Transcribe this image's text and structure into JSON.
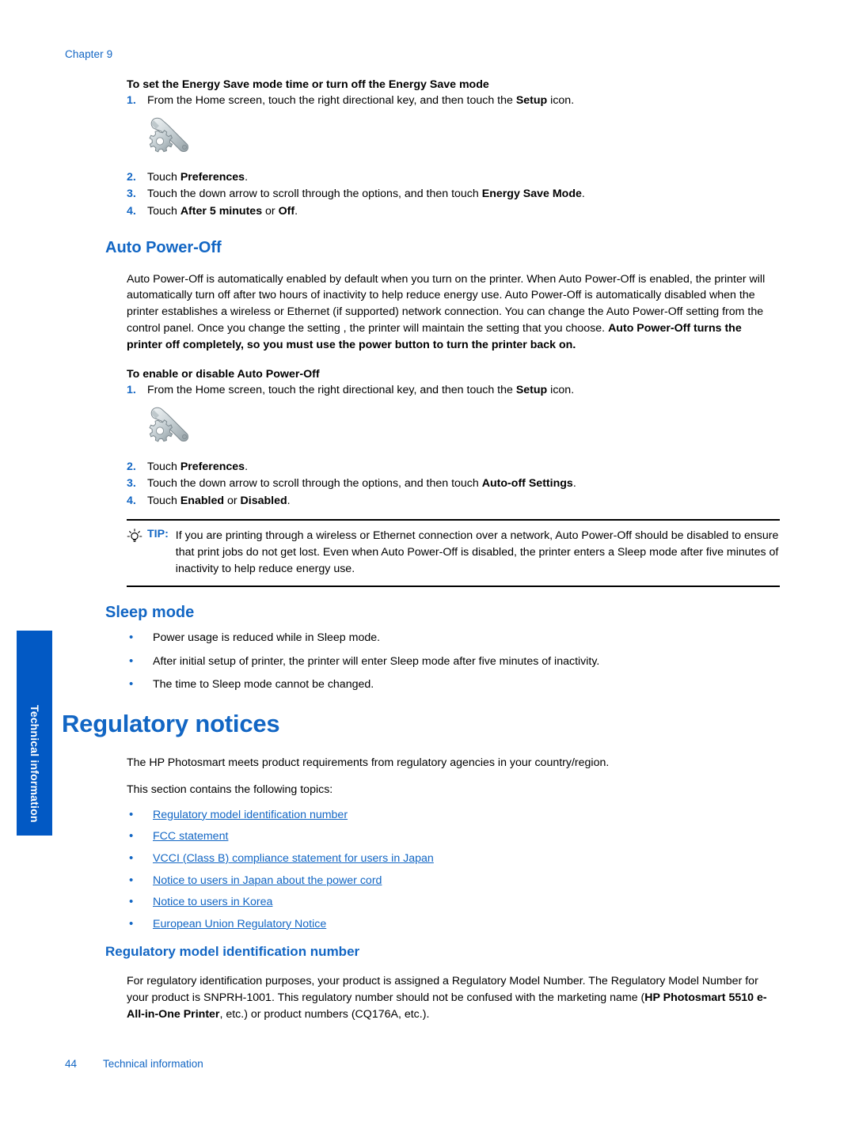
{
  "page": {
    "chapter_label": "Chapter 9",
    "side_tab_label": "Technical information",
    "footer_page_number": "44",
    "footer_section": "Technical information",
    "accent_color": "#1266c4",
    "tab_color": "#0259c4"
  },
  "energy_save": {
    "procedure_title": "To set the Energy Save mode time or turn off the Energy Save mode",
    "steps": [
      {
        "num": "1.",
        "text_html": "From the Home screen, touch the right directional key, and then touch the <b>Setup</b> icon."
      },
      {
        "num": "2.",
        "text_html": "Touch <b>Preferences</b>."
      },
      {
        "num": "3.",
        "text_html": "Touch the down arrow to scroll through the options, and then touch <b>Energy Save Mode</b>."
      },
      {
        "num": "4.",
        "text_html": "Touch <b>After 5 minutes</b> or <b>Off</b>."
      }
    ],
    "setup_icon_name": "setup-wrench-gear-icon"
  },
  "auto_power_off": {
    "heading": "Auto Power-Off",
    "body_html": "Auto Power-Off is automatically enabled by default when you turn on the printer. When Auto Power-Off is enabled, the printer will automatically turn off after two hours of inactivity to help reduce energy use. Auto Power-Off is automatically disabled when the printer establishes a wireless or Ethernet (if supported) network connection. You can change the Auto Power-Off setting from the control panel. Once you change the setting , the printer will maintain the setting that you choose. <b>Auto Power-Off turns the printer off completely, so you must use the power button to turn the printer back on.</b>",
    "procedure_title": "To enable or disable Auto Power-Off",
    "steps": [
      {
        "num": "1.",
        "text_html": "From the Home screen, touch the right directional key, and then touch the <b>Setup</b> icon."
      },
      {
        "num": "2.",
        "text_html": "Touch <b>Preferences</b>."
      },
      {
        "num": "3.",
        "text_html": "Touch the down arrow to scroll through the options, and then touch <b>Auto-off Settings</b>."
      },
      {
        "num": "4.",
        "text_html": "Touch <b>Enabled</b> or <b>Disabled</b>."
      }
    ],
    "tip": {
      "label": "TIP:",
      "icon_name": "lightbulb-tip-icon",
      "text": "If you are printing through a wireless or Ethernet connection over a network, Auto Power-Off should be disabled to ensure that print jobs do not get lost. Even when Auto Power-Off is disabled, the printer enters a Sleep mode after five minutes of inactivity to help reduce energy use."
    }
  },
  "sleep_mode": {
    "heading": "Sleep mode",
    "bullets": [
      "Power usage is reduced while in Sleep mode.",
      "After initial setup of printer, the printer will enter Sleep mode after five minutes of inactivity.",
      "The time to Sleep mode cannot be changed."
    ]
  },
  "regulatory_notices": {
    "heading": "Regulatory notices",
    "intro": "The HP Photosmart meets product requirements from regulatory agencies in your country/region.",
    "topics_intro": "This section contains the following topics:",
    "topics": [
      "Regulatory model identification number",
      "FCC statement",
      "VCCI (Class B) compliance statement for users in Japan",
      "Notice to users in Japan about the power cord",
      "Notice to users in Korea",
      "European Union Regulatory Notice"
    ]
  },
  "regulatory_model": {
    "heading": "Regulatory model identification number",
    "body_html": "For regulatory identification purposes, your product is assigned a Regulatory Model Number. The Regulatory Model Number for your product is SNPRH-1001. This regulatory number should not be confused with the marketing name (<b>HP Photosmart 5510 e-All-in-One Printer</b>, etc.) or product numbers (CQ176A, etc.)."
  }
}
